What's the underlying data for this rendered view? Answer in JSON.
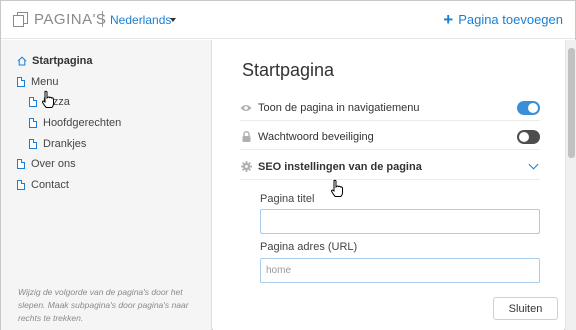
{
  "header": {
    "app_title": "PAGINA'S",
    "language": "Nederlands",
    "add_page_label": "Pagina toevoegen"
  },
  "sidebar": {
    "items": [
      {
        "label": "Startpagina",
        "icon": "home-icon",
        "active": true
      },
      {
        "label": "Menu",
        "icon": "page-icon"
      },
      {
        "label": "Pizza",
        "icon": "page-icon"
      },
      {
        "label": "Hoofdgerechten",
        "icon": "page-icon"
      },
      {
        "label": "Drankjes",
        "icon": "page-icon"
      },
      {
        "label": "Over ons",
        "icon": "page-icon"
      },
      {
        "label": "Contact",
        "icon": "page-icon"
      }
    ],
    "hint": "Wijzig de volgorde van de pagina's door het slepen. Maak subpagina's door pagina's naar rechts te trekken."
  },
  "main": {
    "title": "Startpagina",
    "settings": [
      {
        "label": "Toon de pagina in navigatiemenu",
        "icon": "eye-icon",
        "toggle": true
      },
      {
        "label": "Wachtwoord beveiliging",
        "icon": "lock-icon",
        "toggle": false
      },
      {
        "label": "SEO instellingen van de pagina",
        "icon": "gear-icon",
        "expanded": true
      }
    ],
    "seo": {
      "page_title_label": "Pagina titel",
      "page_title_value": "",
      "page_url_label": "Pagina adres (URL)",
      "page_url_placeholder": "home"
    },
    "close_label": "Sluiten"
  },
  "colors": {
    "accent": "#1a7fd4",
    "toggle_on": "#3b8fd6",
    "toggle_off": "#4d4d4d",
    "sidebar_bg": "#f5f5f5"
  }
}
